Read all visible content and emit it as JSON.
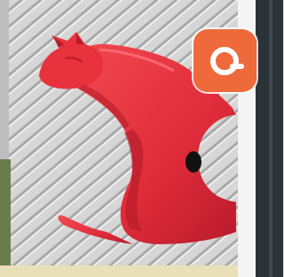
{
  "photo": {
    "subject": "red-cat-sculpture",
    "colors": {
      "siding": "#cfcfcf",
      "siding_shadow": "#9a9a9a",
      "cat_red": "#e8323d",
      "cat_shadow": "#b71c2a",
      "trim": "#f4f4f4",
      "dark_panel": "#2b3238"
    }
  },
  "app_badge": {
    "icon": "lens-search-icon",
    "color": "#ef6a3a"
  }
}
